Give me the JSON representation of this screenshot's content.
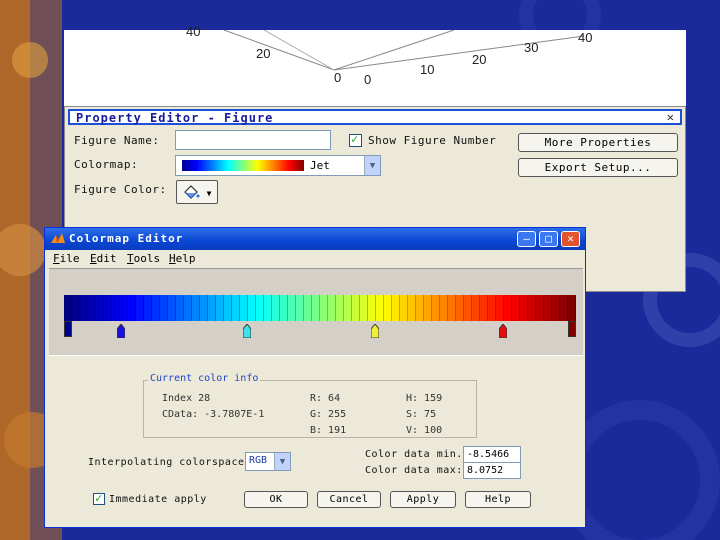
{
  "plot": {
    "ticks": [
      "40",
      "20",
      "0",
      "0",
      "10",
      "20",
      "30",
      "40"
    ]
  },
  "property_editor": {
    "title": "Property Editor - Figure",
    "close_glyph": "✕",
    "figure_name_label": "Figure Name:",
    "figure_name_value": "",
    "show_figure_number_label": "Show Figure Number",
    "colormap_label": "Colormap:",
    "colormap_value": "Jet",
    "figure_color_label": "Figure Color:",
    "more_properties_button": "More Properties",
    "export_setup_button": "Export Setup..."
  },
  "colormap_editor": {
    "title": "Colormap Editor",
    "menus": [
      {
        "key": "F",
        "rest": "ile"
      },
      {
        "key": "E",
        "rest": "dit"
      },
      {
        "key": "T",
        "rest": "ools"
      },
      {
        "key": "H",
        "rest": "elp"
      }
    ],
    "marker_colors": [
      "#1a0fe0",
      "#3de2e8",
      "#f0f03a",
      "#e01010"
    ],
    "color_info": {
      "group_label": "Current color info",
      "index": "Index 28",
      "cdata": "CData: -3.7807E-1",
      "r": "R: 64",
      "g": "G: 255",
      "b": "B: 191",
      "h": "H: 159",
      "s": "S: 75",
      "v": "V: 100"
    },
    "interp_label": "Interpolating colorspace:",
    "interp_value": "RGB",
    "cdata_min_label": "Color data min.",
    "cdata_min_value": "-8.5466",
    "cdata_max_label": "Color data max:",
    "cdata_max_value": "8.0752",
    "immediate_apply_label": "Immediate apply",
    "ok_button": "OK",
    "cancel_button": "Cancel",
    "apply_button": "Apply",
    "help_button": "Help"
  },
  "colors": {
    "background": "#1a2a9a",
    "titlebar_blue": "#0a46d3",
    "close_red": "#e2542d",
    "property_title_text": "#1a1aa0"
  }
}
